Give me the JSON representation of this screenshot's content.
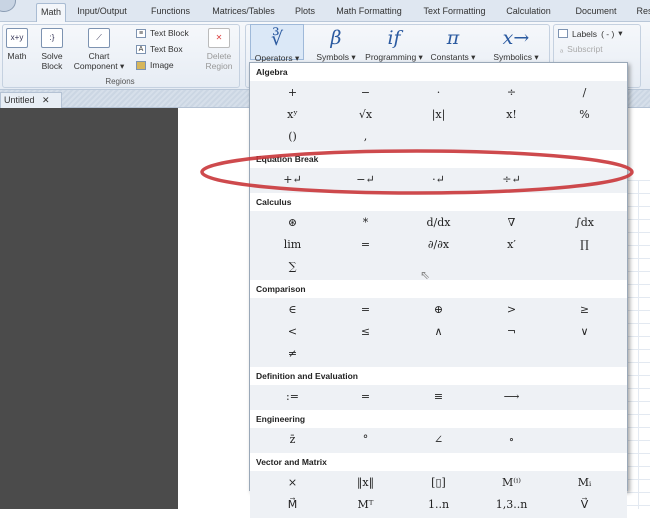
{
  "ribbon_tabs": [
    "Math",
    "Input/Output",
    "Functions",
    "Matrices/Tables",
    "Plots",
    "Math Formatting",
    "Text Formatting",
    "Calculation",
    "Document",
    "Reso"
  ],
  "active_tab": "Math",
  "regions": {
    "math": "Math",
    "math_icon": "x+y",
    "solve_block": [
      "Solve",
      "Block"
    ],
    "chart": [
      "Chart",
      "Component"
    ],
    "text_block": "Text Block",
    "text_box": "Text Box",
    "image": "Image",
    "delete_region": [
      "Delete",
      "Region"
    ],
    "group_label": "Regions"
  },
  "operators_group": [
    {
      "glyph": "∛",
      "label": "Operators"
    },
    {
      "glyph": "β",
      "label": "Symbols"
    },
    {
      "glyph": "if",
      "label": "Programming"
    },
    {
      "glyph": "π",
      "label": "Constants"
    },
    {
      "glyph": "x→",
      "label": "Symbolics"
    }
  ],
  "labels_group": {
    "labels": "Labels",
    "labels_value": "( - )",
    "subscript": "Subscript"
  },
  "document_tab": {
    "title": "Untitled",
    "close": "✕"
  },
  "dropdown": {
    "sections": [
      {
        "title": "Algebra",
        "symbols": [
          "+",
          "−",
          "·",
          "÷",
          "/",
          "xʸ",
          "√x",
          "|x|",
          "x!",
          "%",
          "()",
          ","
        ]
      },
      {
        "title": "Equation Break",
        "symbols": [
          "+↵",
          "−↵",
          "·↵",
          "÷↵"
        ]
      },
      {
        "title": "Calculus",
        "symbols": [
          "⊛",
          "*",
          "d/dx",
          "∇",
          "∫dx",
          "lim",
          "=",
          "∂/∂x",
          "x′",
          "∏",
          "∑"
        ]
      },
      {
        "title": "Comparison",
        "symbols": [
          "∈",
          "=",
          "⊕",
          ">",
          "≥",
          "<",
          "≤",
          "∧",
          "¬",
          "∨",
          "≠"
        ]
      },
      {
        "title": "Definition and Evaluation",
        "symbols": [
          ":=",
          "=",
          "≡",
          "⟶"
        ]
      },
      {
        "title": "Engineering",
        "symbols": [
          "z̄",
          "°",
          "∠",
          "∘"
        ]
      },
      {
        "title": "Vector and Matrix",
        "symbols": [
          "×",
          "‖x‖",
          "[▯]",
          "M⁽ⁱ⁾",
          "Mᵢ",
          "M⃗",
          "Mᵀ",
          "1..n",
          "1,3..n",
          "V⃗"
        ]
      }
    ]
  },
  "annotation_color": "#c9363a"
}
